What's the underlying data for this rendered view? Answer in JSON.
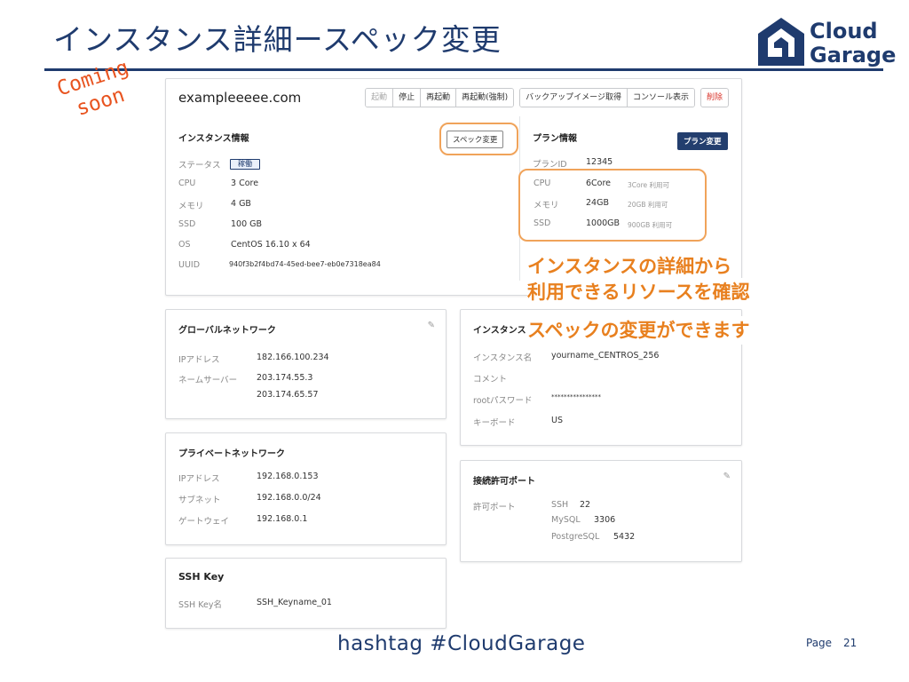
{
  "slide": {
    "title": "インスタンス詳細ースペック変更",
    "coming_soon": [
      "Coming",
      "soon"
    ],
    "annotation_lines": [
      "インスタンスの詳細から",
      "利用できるリソースを確認",
      "スペックの変更ができます"
    ],
    "footer_tag": "hashtag  #CloudGarage",
    "page_label": "Page",
    "page_number": "21",
    "logo": {
      "line1": "Cloud",
      "line2": "Garage"
    },
    "colors": {
      "title": "#1f3b6e",
      "accent": "#e8801f",
      "highlight": "#f0a35a",
      "primary": "#233e6e",
      "danger": "#d9342b"
    }
  },
  "instance": {
    "hostname": "exampleeeee.com",
    "actions": {
      "group1": [
        "起動",
        "停止",
        "再起動",
        "再起動(強制)"
      ],
      "group2": [
        "バックアップイメージ取得",
        "コンソール表示"
      ],
      "delete": "削除"
    },
    "info": {
      "title": "インスタンス情報",
      "spec_change_button": "スペック変更",
      "rows": [
        {
          "label": "ステータス",
          "value": "稼働"
        },
        {
          "label": "CPU",
          "value": "3 Core"
        },
        {
          "label": "メモリ",
          "value": "4 GB"
        },
        {
          "label": "SSD",
          "value": "100 GB"
        },
        {
          "label": "OS",
          "value": "CentOS 16.10 x 64"
        },
        {
          "label": "UUID",
          "value": "940f3b2f4bd74-45ed-bee7-eb0e7318ea84"
        }
      ]
    },
    "plan": {
      "title": "プラン情報",
      "change_button": "プラン変更",
      "plan_id_label": "プランID",
      "plan_id": "12345",
      "rows": [
        {
          "label": "CPU",
          "value": "6Core",
          "note": "3Core 利用可"
        },
        {
          "label": "メモリ",
          "value": "24GB",
          "note": "20GB 利用可"
        },
        {
          "label": "SSD",
          "value": "1000GB",
          "note": "900GB 利用可"
        }
      ]
    }
  },
  "global_network": {
    "title": "グローバルネットワーク",
    "ip_label": "IPアドレス",
    "ip": "182.166.100.234",
    "ns_label": "ネームサーバー",
    "ns1": "203.174.55.3",
    "ns2": "203.174.65.57"
  },
  "instance_card": {
    "title": "インスタンス",
    "rows": [
      {
        "label": "インスタンス名",
        "value": "yourname_CENTROS_256"
      },
      {
        "label": "コメント",
        "value": ""
      },
      {
        "label": "rootパスワード",
        "value": "****************"
      },
      {
        "label": "キーボード",
        "value": "US"
      }
    ]
  },
  "private_network": {
    "title": "プライベートネットワーク",
    "rows": [
      {
        "label": "IPアドレス",
        "value": "192.168.0.153"
      },
      {
        "label": "サブネット",
        "value": "192.168.0.0/24"
      },
      {
        "label": "ゲートウェイ",
        "value": "192.168.0.1"
      }
    ]
  },
  "ports": {
    "title": "接続許可ポート",
    "label": "許可ポート",
    "rows": [
      {
        "name": "SSH",
        "port": "22"
      },
      {
        "name": "MySQL",
        "port": "3306"
      },
      {
        "name": "PostgreSQL",
        "port": "5432"
      }
    ]
  },
  "ssh_key": {
    "title": "SSH Key",
    "label": "SSH Key名",
    "value": "SSH_Keyname_01"
  }
}
